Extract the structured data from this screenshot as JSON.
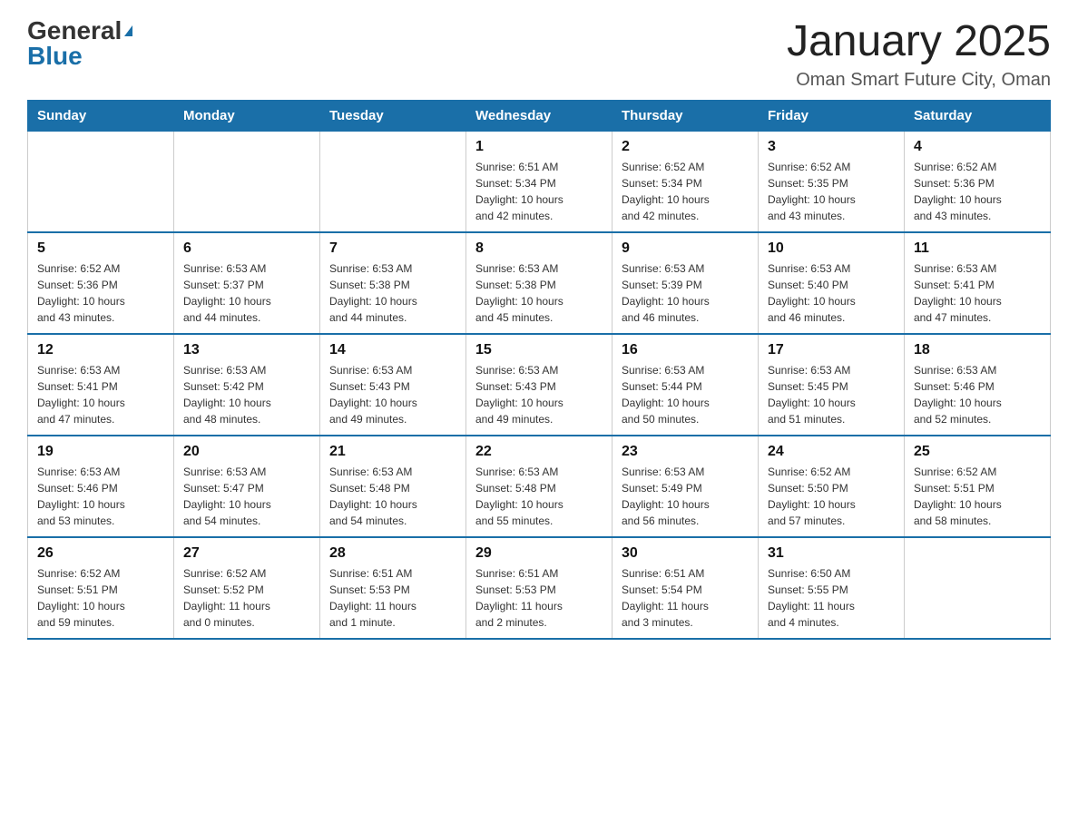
{
  "logo": {
    "general": "General",
    "blue": "Blue"
  },
  "title": "January 2025",
  "subtitle": "Oman Smart Future City, Oman",
  "days_of_week": [
    "Sunday",
    "Monday",
    "Tuesday",
    "Wednesday",
    "Thursday",
    "Friday",
    "Saturday"
  ],
  "weeks": [
    [
      {
        "day": "",
        "info": ""
      },
      {
        "day": "",
        "info": ""
      },
      {
        "day": "",
        "info": ""
      },
      {
        "day": "1",
        "info": "Sunrise: 6:51 AM\nSunset: 5:34 PM\nDaylight: 10 hours\nand 42 minutes."
      },
      {
        "day": "2",
        "info": "Sunrise: 6:52 AM\nSunset: 5:34 PM\nDaylight: 10 hours\nand 42 minutes."
      },
      {
        "day": "3",
        "info": "Sunrise: 6:52 AM\nSunset: 5:35 PM\nDaylight: 10 hours\nand 43 minutes."
      },
      {
        "day": "4",
        "info": "Sunrise: 6:52 AM\nSunset: 5:36 PM\nDaylight: 10 hours\nand 43 minutes."
      }
    ],
    [
      {
        "day": "5",
        "info": "Sunrise: 6:52 AM\nSunset: 5:36 PM\nDaylight: 10 hours\nand 43 minutes."
      },
      {
        "day": "6",
        "info": "Sunrise: 6:53 AM\nSunset: 5:37 PM\nDaylight: 10 hours\nand 44 minutes."
      },
      {
        "day": "7",
        "info": "Sunrise: 6:53 AM\nSunset: 5:38 PM\nDaylight: 10 hours\nand 44 minutes."
      },
      {
        "day": "8",
        "info": "Sunrise: 6:53 AM\nSunset: 5:38 PM\nDaylight: 10 hours\nand 45 minutes."
      },
      {
        "day": "9",
        "info": "Sunrise: 6:53 AM\nSunset: 5:39 PM\nDaylight: 10 hours\nand 46 minutes."
      },
      {
        "day": "10",
        "info": "Sunrise: 6:53 AM\nSunset: 5:40 PM\nDaylight: 10 hours\nand 46 minutes."
      },
      {
        "day": "11",
        "info": "Sunrise: 6:53 AM\nSunset: 5:41 PM\nDaylight: 10 hours\nand 47 minutes."
      }
    ],
    [
      {
        "day": "12",
        "info": "Sunrise: 6:53 AM\nSunset: 5:41 PM\nDaylight: 10 hours\nand 47 minutes."
      },
      {
        "day": "13",
        "info": "Sunrise: 6:53 AM\nSunset: 5:42 PM\nDaylight: 10 hours\nand 48 minutes."
      },
      {
        "day": "14",
        "info": "Sunrise: 6:53 AM\nSunset: 5:43 PM\nDaylight: 10 hours\nand 49 minutes."
      },
      {
        "day": "15",
        "info": "Sunrise: 6:53 AM\nSunset: 5:43 PM\nDaylight: 10 hours\nand 49 minutes."
      },
      {
        "day": "16",
        "info": "Sunrise: 6:53 AM\nSunset: 5:44 PM\nDaylight: 10 hours\nand 50 minutes."
      },
      {
        "day": "17",
        "info": "Sunrise: 6:53 AM\nSunset: 5:45 PM\nDaylight: 10 hours\nand 51 minutes."
      },
      {
        "day": "18",
        "info": "Sunrise: 6:53 AM\nSunset: 5:46 PM\nDaylight: 10 hours\nand 52 minutes."
      }
    ],
    [
      {
        "day": "19",
        "info": "Sunrise: 6:53 AM\nSunset: 5:46 PM\nDaylight: 10 hours\nand 53 minutes."
      },
      {
        "day": "20",
        "info": "Sunrise: 6:53 AM\nSunset: 5:47 PM\nDaylight: 10 hours\nand 54 minutes."
      },
      {
        "day": "21",
        "info": "Sunrise: 6:53 AM\nSunset: 5:48 PM\nDaylight: 10 hours\nand 54 minutes."
      },
      {
        "day": "22",
        "info": "Sunrise: 6:53 AM\nSunset: 5:48 PM\nDaylight: 10 hours\nand 55 minutes."
      },
      {
        "day": "23",
        "info": "Sunrise: 6:53 AM\nSunset: 5:49 PM\nDaylight: 10 hours\nand 56 minutes."
      },
      {
        "day": "24",
        "info": "Sunrise: 6:52 AM\nSunset: 5:50 PM\nDaylight: 10 hours\nand 57 minutes."
      },
      {
        "day": "25",
        "info": "Sunrise: 6:52 AM\nSunset: 5:51 PM\nDaylight: 10 hours\nand 58 minutes."
      }
    ],
    [
      {
        "day": "26",
        "info": "Sunrise: 6:52 AM\nSunset: 5:51 PM\nDaylight: 10 hours\nand 59 minutes."
      },
      {
        "day": "27",
        "info": "Sunrise: 6:52 AM\nSunset: 5:52 PM\nDaylight: 11 hours\nand 0 minutes."
      },
      {
        "day": "28",
        "info": "Sunrise: 6:51 AM\nSunset: 5:53 PM\nDaylight: 11 hours\nand 1 minute."
      },
      {
        "day": "29",
        "info": "Sunrise: 6:51 AM\nSunset: 5:53 PM\nDaylight: 11 hours\nand 2 minutes."
      },
      {
        "day": "30",
        "info": "Sunrise: 6:51 AM\nSunset: 5:54 PM\nDaylight: 11 hours\nand 3 minutes."
      },
      {
        "day": "31",
        "info": "Sunrise: 6:50 AM\nSunset: 5:55 PM\nDaylight: 11 hours\nand 4 minutes."
      },
      {
        "day": "",
        "info": ""
      }
    ]
  ]
}
